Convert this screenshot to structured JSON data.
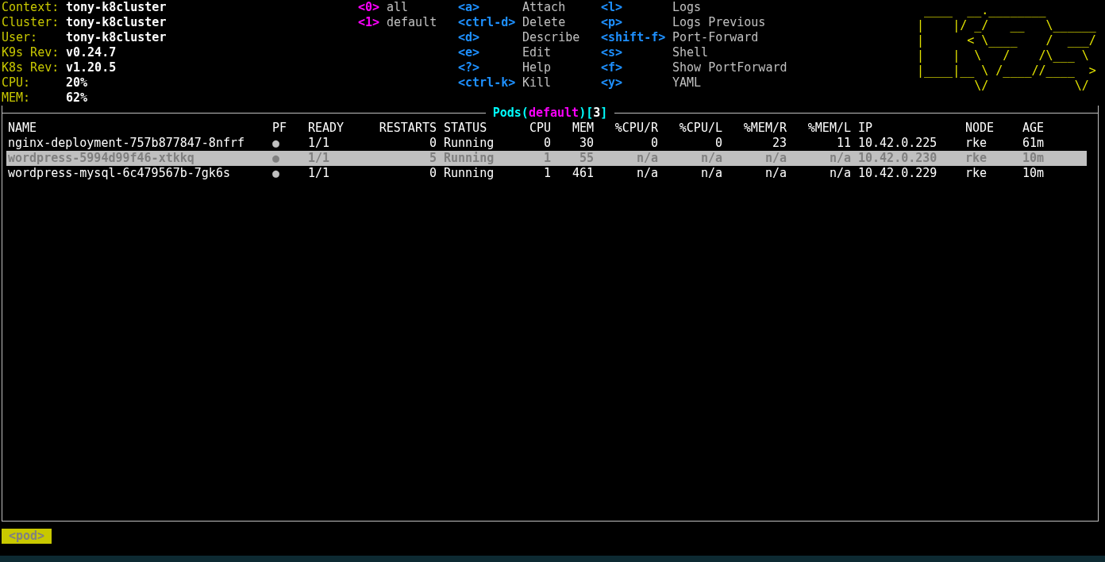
{
  "cluster_info": [
    {
      "label": "Context:",
      "value": "tony-k8cluster"
    },
    {
      "label": "Cluster:",
      "value": "tony-k8cluster"
    },
    {
      "label": "User:",
      "value": "tony-k8cluster"
    },
    {
      "label": "K9s Rev:",
      "value": "v0.24.7"
    },
    {
      "label": "K8s Rev:",
      "value": "v1.20.5"
    },
    {
      "label": "CPU:",
      "value": "20%"
    },
    {
      "label": "MEM:",
      "value": "62%"
    }
  ],
  "namespaces": [
    {
      "key": "<0>",
      "label": "all"
    },
    {
      "key": "<1>",
      "label": "default"
    }
  ],
  "commands": [
    [
      {
        "key": "<a>",
        "label": "Attach"
      },
      {
        "key": "<ctrl-d>",
        "label": "Delete"
      },
      {
        "key": "<d>",
        "label": "Describe"
      },
      {
        "key": "<e>",
        "label": "Edit"
      },
      {
        "key": "<?>",
        "label": "Help"
      },
      {
        "key": "<ctrl-k>",
        "label": "Kill"
      }
    ],
    [
      {
        "key": "<l>",
        "label": "Logs"
      },
      {
        "key": "<p>",
        "label": "Logs Previous"
      },
      {
        "key": "<shift-f>",
        "label": "Port-Forward"
      },
      {
        "key": "<s>",
        "label": "Shell"
      },
      {
        "key": "<f>",
        "label": "Show PortForward"
      },
      {
        "key": "<y>",
        "label": "YAML"
      }
    ]
  ],
  "logo": [
    " ____  __.________       ",
    "|    |/ _/   __   \\______",
    "|      < \\____    /  ___/",
    "|    |  \\   /    /\\___ \\ ",
    "|____|__ \\ /____//____  >",
    "        \\/            \\/ "
  ],
  "table": {
    "title": [
      {
        "text": "Pods(",
        "kind": "resource"
      },
      {
        "text": "default",
        "kind": "namespace"
      },
      {
        "text": ")[",
        "kind": "resource"
      },
      {
        "text": "3",
        "kind": "count"
      },
      {
        "text": "]",
        "kind": "resource"
      }
    ],
    "columns": [
      "NAME",
      "PF",
      "READY",
      "RESTARTS",
      "STATUS",
      "CPU",
      "MEM",
      "%CPU/R",
      "%CPU/L",
      "%MEM/R",
      "%MEM/L",
      "IP",
      "NODE",
      "AGE"
    ],
    "rows": [
      {
        "selected": false,
        "cells": [
          "nginx-deployment-757b877847-8nfrf",
          "●",
          "1/1",
          "0",
          "Running",
          "0",
          "30",
          "0",
          "0",
          "23",
          "11",
          "10.42.0.225",
          "rke",
          "61m"
        ]
      },
      {
        "selected": true,
        "cells": [
          "wordpress-5994d99f46-xtkkq",
          "●",
          "1/1",
          "5",
          "Running",
          "1",
          "55",
          "n/a",
          "n/a",
          "n/a",
          "n/a",
          "10.42.0.230",
          "rke",
          "10m"
        ]
      },
      {
        "selected": false,
        "cells": [
          "wordpress-mysql-6c479567b-7gk6s",
          "●",
          "1/1",
          "0",
          "Running",
          "1",
          "461",
          "n/a",
          "n/a",
          "n/a",
          "n/a",
          "10.42.0.229",
          "rke",
          "10m"
        ]
      }
    ]
  },
  "breadcrumbs": [
    "<pod>"
  ]
}
